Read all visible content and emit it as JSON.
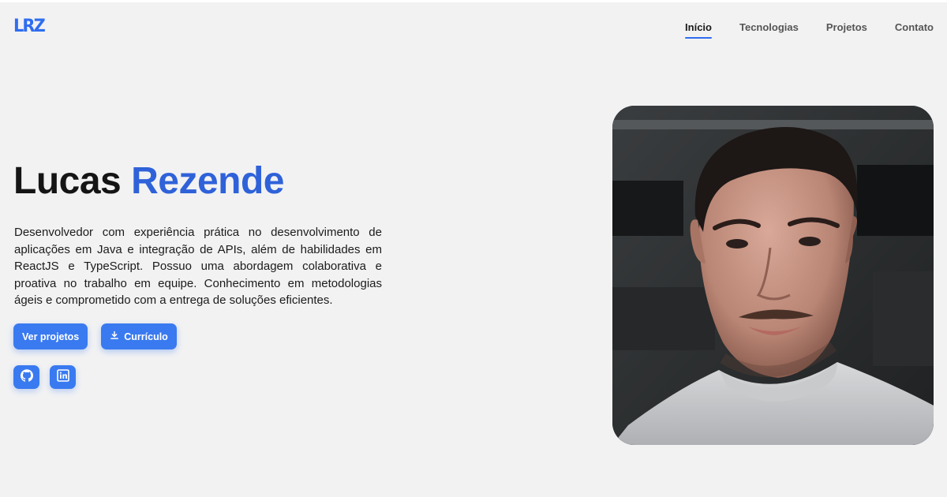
{
  "brand": {
    "logo_text": "LRZ"
  },
  "nav": {
    "items": [
      {
        "label": "Início",
        "active": true
      },
      {
        "label": "Tecnologias",
        "active": false
      },
      {
        "label": "Projetos",
        "active": false
      },
      {
        "label": "Contato",
        "active": false
      }
    ]
  },
  "hero": {
    "first_name": "Lucas",
    "last_name": "Rezende",
    "description": "Desenvolvedor com experiência prática no desenvolvimento de aplicações em Java e integração de APIs, além de habilidades em ReactJS e TypeScript. Possuo uma abordagem colaborativa e proativa no trabalho em equipe. Conhecimento em metodologias ágeis e comprometido com a entrega de soluções eficientes.",
    "projects_button": "Ver projetos",
    "resume_button": "Currículo",
    "resume_icon": "download-icon",
    "socials": [
      {
        "icon": "github-icon"
      },
      {
        "icon": "linkedin-icon"
      }
    ]
  },
  "colors": {
    "accent": "#2f6df0",
    "background": "#f2f2f3",
    "text": "#151515"
  }
}
